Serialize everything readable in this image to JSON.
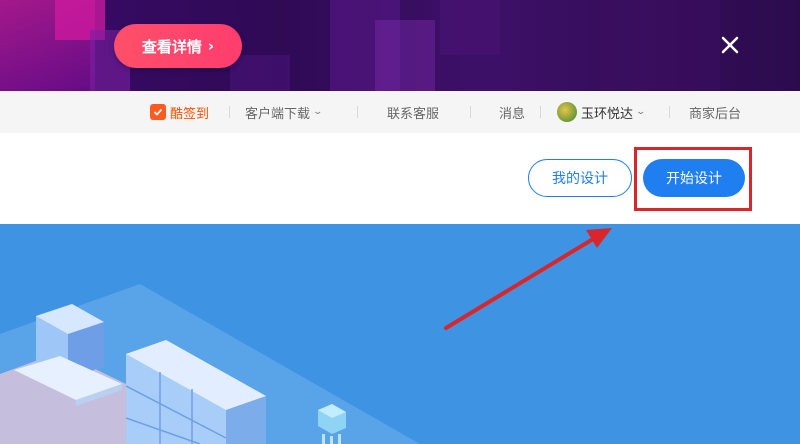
{
  "banner": {
    "detail_label": "查看详情",
    "detail_arrow": "›",
    "close_icon": "close-icon"
  },
  "topnav": {
    "checkin_label": "酷签到",
    "client_download_label": "客户端下载",
    "customer_service_label": "联系客服",
    "messages_label": "消息",
    "user_name": "玉环悦达",
    "merchant_backend_label": "商家后台"
  },
  "header": {
    "my_design_label": "我的设计",
    "start_design_label": "开始设计"
  },
  "colors": {
    "accent_blue": "#1f7ef0",
    "hero_blue": "#3f93e3",
    "promo_pink": "#ff4f6a",
    "highlight_red": "#d9262a",
    "checkin_orange": "#ff5000"
  }
}
